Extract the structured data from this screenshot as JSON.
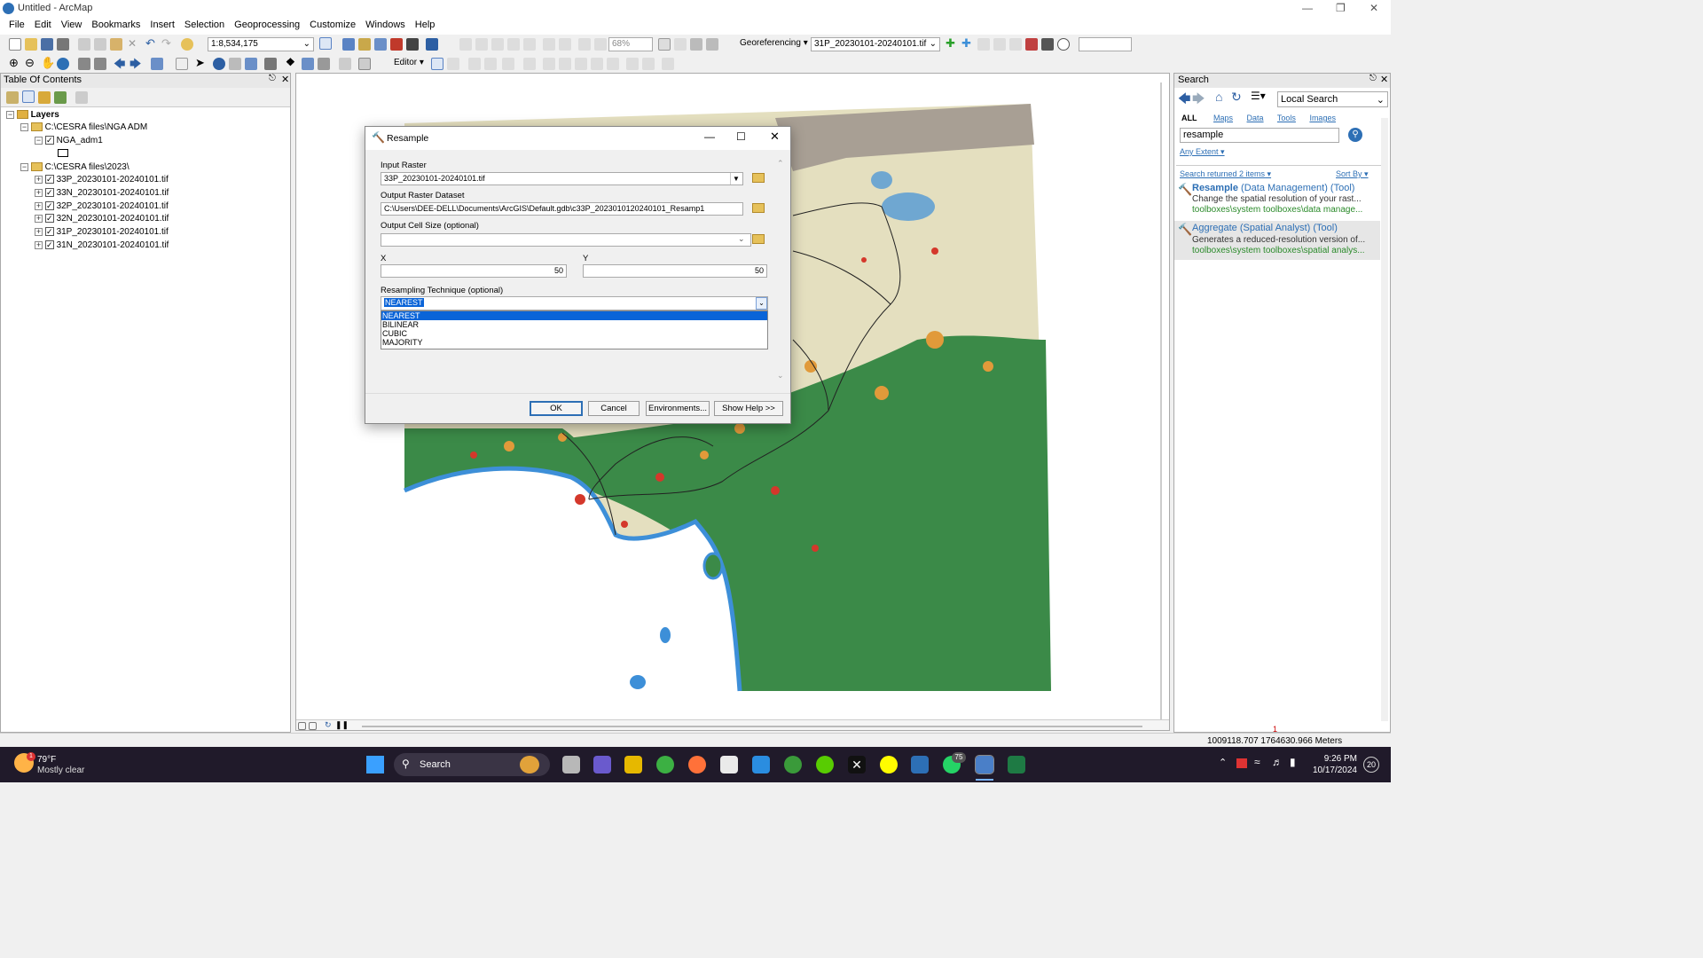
{
  "window": {
    "title": "Untitled - ArcMap"
  },
  "menu": [
    "File",
    "Edit",
    "View",
    "Bookmarks",
    "Insert",
    "Selection",
    "Geoprocessing",
    "Customize",
    "Windows",
    "Help"
  ],
  "toolbar": {
    "scale": "1:8,534,175",
    "zoom_pct": "68%",
    "georef_label": "Georeferencing",
    "georef_layer": "31P_20230101-20240101.tif",
    "editor_label": "Editor"
  },
  "toc": {
    "title": "Table Of Contents",
    "root": "Layers",
    "group1": "C:\\CESRA files\\NGA ADM",
    "group1_layer": "NGA_adm1",
    "group2": "C:\\CESRA files\\2023\\",
    "group2_layers": [
      "33P_20230101-20240101.tif",
      "33N_20230101-20240101.tif",
      "32P_20230101-20240101.tif",
      "32N_20230101-20240101.tif",
      "31P_20230101-20240101.tif",
      "31N_20230101-20240101.tif"
    ]
  },
  "dialog": {
    "title": "Resample",
    "input_raster_label": "Input Raster",
    "input_raster_value": "33P_20230101-20240101.tif",
    "output_label": "Output Raster Dataset",
    "output_value": "C:\\Users\\DEE-DELL\\Documents\\ArcGIS\\Default.gdb\\c33P_2023010120240101_Resamp1",
    "cellsize_label": "Output Cell Size (optional)",
    "x_label": "X",
    "x_value": "50",
    "y_label": "Y",
    "y_value": "50",
    "technique_label": "Resampling Technique (optional)",
    "technique_value": "NEAREST",
    "technique_options": [
      "NEAREST",
      "BILINEAR",
      "CUBIC",
      "MAJORITY"
    ],
    "ok": "OK",
    "cancel": "Cancel",
    "environments": "Environments...",
    "show_help": "Show Help >>"
  },
  "search": {
    "title": "Search",
    "scope": "Local Search",
    "tabs": [
      "ALL",
      "Maps",
      "Data",
      "Tools",
      "Images"
    ],
    "query": "resample",
    "extent": "Any Extent",
    "returned": "Search returned 2 items",
    "sort": "Sort By",
    "results": [
      {
        "name": "Resample",
        "suffix": "(Data Management) (Tool)",
        "desc": "Change the spatial resolution of your rast...",
        "path": "toolboxes\\system toolboxes\\data manage..."
      },
      {
        "name": "Aggregate (Spatial Analyst)",
        "suffix": "(Tool)",
        "desc": "Generates a reduced-resolution version of...",
        "path": "toolboxes\\system toolboxes\\spatial analys..."
      }
    ]
  },
  "status": {
    "coords": "1009118.707  1764630.966 Meters",
    "marker": "1"
  },
  "taskbar": {
    "weather_temp": "79°F",
    "weather_desc": "Mostly clear",
    "weather_badge": "1",
    "search": "Search",
    "time": "9:26 PM",
    "date": "10/17/2024",
    "notif_count": "20",
    "whatsapp_badge": "75"
  },
  "colors": {
    "forest": "#3b8a48",
    "bare": "#e4dfbf",
    "ground": "#a89f94",
    "water": "#3d8fd8",
    "crop": "#e19a3a",
    "built": "#d4382b",
    "select_blue": "#0a64d8"
  }
}
